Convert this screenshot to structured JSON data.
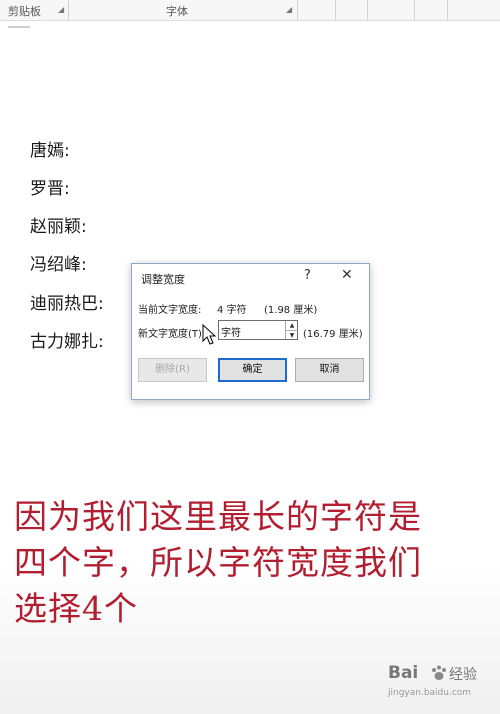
{
  "ribbon": {
    "group_clipboard": "剪贴板",
    "group_font": "字体"
  },
  "document": {
    "lines": [
      "唐嫣:",
      "罗晋:",
      "赵丽颖:",
      "冯绍峰:",
      "迪丽热巴:",
      "古力娜扎:"
    ]
  },
  "dialog": {
    "title": "调整宽度",
    "help_label": "?",
    "close_label": "✕",
    "current_label": "当前文字宽度:",
    "current_value": "4 字符",
    "current_cm": "(1.98 厘米)",
    "new_label": "新文字宽度(T):",
    "new_value": "字符",
    "new_cm": "(16.79 厘米)",
    "delete_button": "删除(R)",
    "ok_button": "确定",
    "cancel_button": "取消"
  },
  "caption": {
    "line1": "因为我们这里最长的字符是",
    "line2": "四个字，所以字符宽度我们",
    "line3": "选择4个"
  },
  "watermark": {
    "logo": "Bai",
    "text": "经验",
    "url": "jingyan.baidu.com"
  },
  "colors": {
    "caption": "#b21e2f",
    "primary_border": "#1b6bd0",
    "dialog_border": "#8fa8c8"
  }
}
